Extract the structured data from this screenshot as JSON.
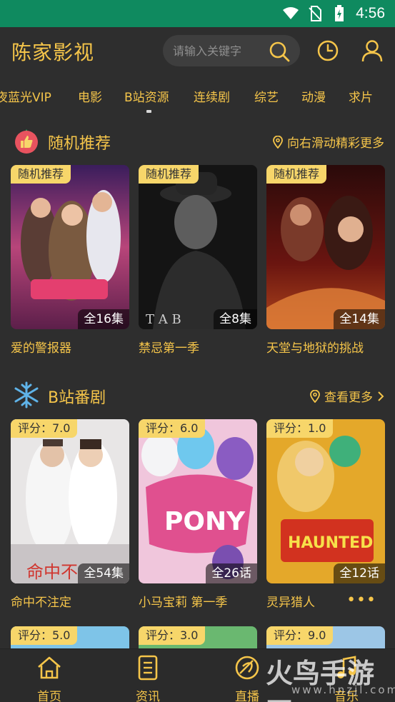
{
  "status_bar": {
    "time": "4:56",
    "icons": [
      "wifi-icon",
      "no-sim-icon",
      "battery-charging-icon"
    ]
  },
  "header": {
    "title": "陈家影视",
    "search_placeholder": "请输入关键字",
    "icons": [
      "search-icon",
      "history-clock-icon",
      "user-icon"
    ]
  },
  "tabs": [
    {
      "label": "夜蓝光VIP"
    },
    {
      "label": "电影"
    },
    {
      "label": "B站资源",
      "active": true
    },
    {
      "label": "连续剧"
    },
    {
      "label": "综艺"
    },
    {
      "label": "动漫"
    },
    {
      "label": "求片"
    }
  ],
  "section_random": {
    "title": "随机推荐",
    "more": "向右滑动精彩更多",
    "icon": "thumbs-up-icon",
    "cards": [
      {
        "tag": "随机推荐",
        "episodes": "全16集",
        "title": "爱的警报器"
      },
      {
        "tag": "随机推荐",
        "episodes": "全8集",
        "title": "禁忌第一季"
      },
      {
        "tag": "随机推荐",
        "episodes": "全14集",
        "title": "天堂与地狱的挑战"
      }
    ]
  },
  "section_bilibili": {
    "title": "B站番剧",
    "more": "查看更多",
    "icon": "snowflake-icon",
    "cards": [
      {
        "tag": "评分：7.0",
        "episodes": "全54集",
        "title": "命中不注定"
      },
      {
        "tag": "评分：6.0",
        "episodes": "全26话",
        "title": "小马宝莉 第一季"
      },
      {
        "tag": "评分：1.0",
        "episodes": "全12话",
        "title": "灵异猎人"
      }
    ],
    "more_dots": "•••"
  },
  "section_row3": {
    "cards": [
      {
        "tag": "评分：5.0"
      },
      {
        "tag": "评分：3.0"
      },
      {
        "tag": "评分：9.0"
      }
    ]
  },
  "bottom_nav": [
    {
      "label": "首页",
      "icon": "home-icon"
    },
    {
      "label": "资讯",
      "icon": "news-icon"
    },
    {
      "label": "直播",
      "icon": "live-icon"
    },
    {
      "label": "音乐",
      "icon": "music-icon"
    }
  ],
  "watermark": {
    "text": "火鸟手游网",
    "sub": "www.hnzjl.com"
  },
  "colors": {
    "accent": "#f5c54a",
    "background": "#2e2e2e",
    "status_bar": "#0f8a5f",
    "tag": "#f7d66a"
  }
}
